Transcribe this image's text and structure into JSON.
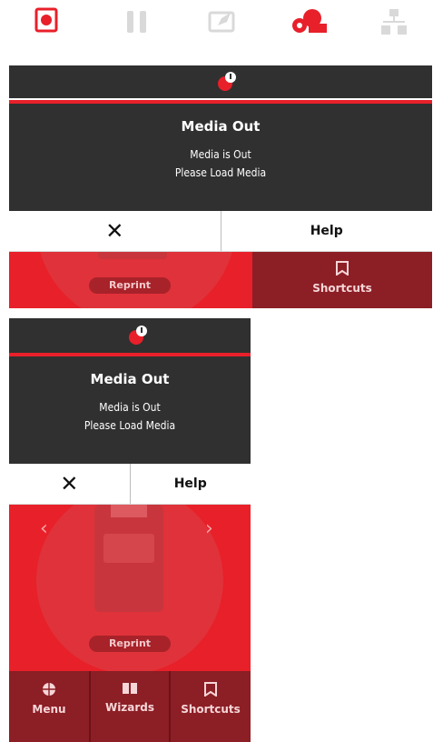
{
  "status_icons": [
    "printer-status-icon",
    "pause-icon",
    "media-icon",
    "ribbon-icon",
    "network-icon"
  ],
  "colors": {
    "accent": "#e8202a",
    "dark": "#303030",
    "nav": "#8c1e25"
  },
  "dialog1": {
    "title": "Media Out",
    "line1": "Media is Out",
    "line2": "Please Load Media",
    "close_label": "✕",
    "help_label": "Help",
    "reprint_label": "Reprint",
    "shortcuts_label": "Shortcuts"
  },
  "dialog2": {
    "title": "Media Out",
    "line1": "Media is Out",
    "line2": "Please Load Media",
    "close_label": "✕",
    "help_label": "Help",
    "reprint_label": "Reprint",
    "nav": [
      {
        "label": "Menu",
        "icon": "globe-icon"
      },
      {
        "label": "Wizards",
        "icon": "book-icon"
      },
      {
        "label": "Shortcuts",
        "icon": "bookmark-icon"
      }
    ],
    "prev": "‹",
    "next": "›"
  }
}
